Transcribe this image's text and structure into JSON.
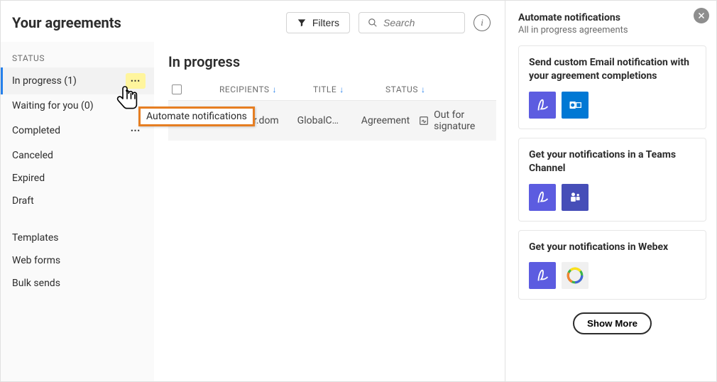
{
  "header": {
    "title": "Your agreements",
    "filters_label": "Filters",
    "search_placeholder": "Search"
  },
  "sidebar": {
    "section_label": "STATUS",
    "items": [
      {
        "label": "In progress (1)",
        "selected": true,
        "has_more": true
      },
      {
        "label": "Waiting for you (0)",
        "selected": false,
        "has_more": false
      },
      {
        "label": "Completed",
        "selected": false,
        "has_more": true
      },
      {
        "label": "Canceled",
        "selected": false,
        "has_more": false
      },
      {
        "label": "Expired",
        "selected": false,
        "has_more": false
      },
      {
        "label": "Draft",
        "selected": false,
        "has_more": false
      }
    ],
    "other": [
      {
        "label": "Templates"
      },
      {
        "label": "Web forms"
      },
      {
        "label": "Bulk sends"
      }
    ]
  },
  "tooltip": {
    "label": "Automate notifications"
  },
  "list": {
    "title": "In progress",
    "columns": {
      "recipients": "RECIPIENTS",
      "title": "TITLE",
      "status": "STATUS"
    },
    "rows": [
      {
        "recipient": "e@jupiter.dom",
        "title": "GlobalC…",
        "type": "Agreement",
        "status": "Out for signature"
      }
    ]
  },
  "right_panel": {
    "title": "Automate notifications",
    "subtitle": "All in progress agreements",
    "cards": [
      {
        "title": "Send custom Email notification with your agreement completions",
        "apps": [
          "acrobat",
          "outlook"
        ]
      },
      {
        "title": "Get your notifications in a Teams Channel",
        "apps": [
          "acrobat",
          "teams"
        ]
      },
      {
        "title": "Get your notifications in Webex",
        "apps": [
          "acrobat",
          "webex"
        ]
      }
    ],
    "show_more": "Show More"
  }
}
